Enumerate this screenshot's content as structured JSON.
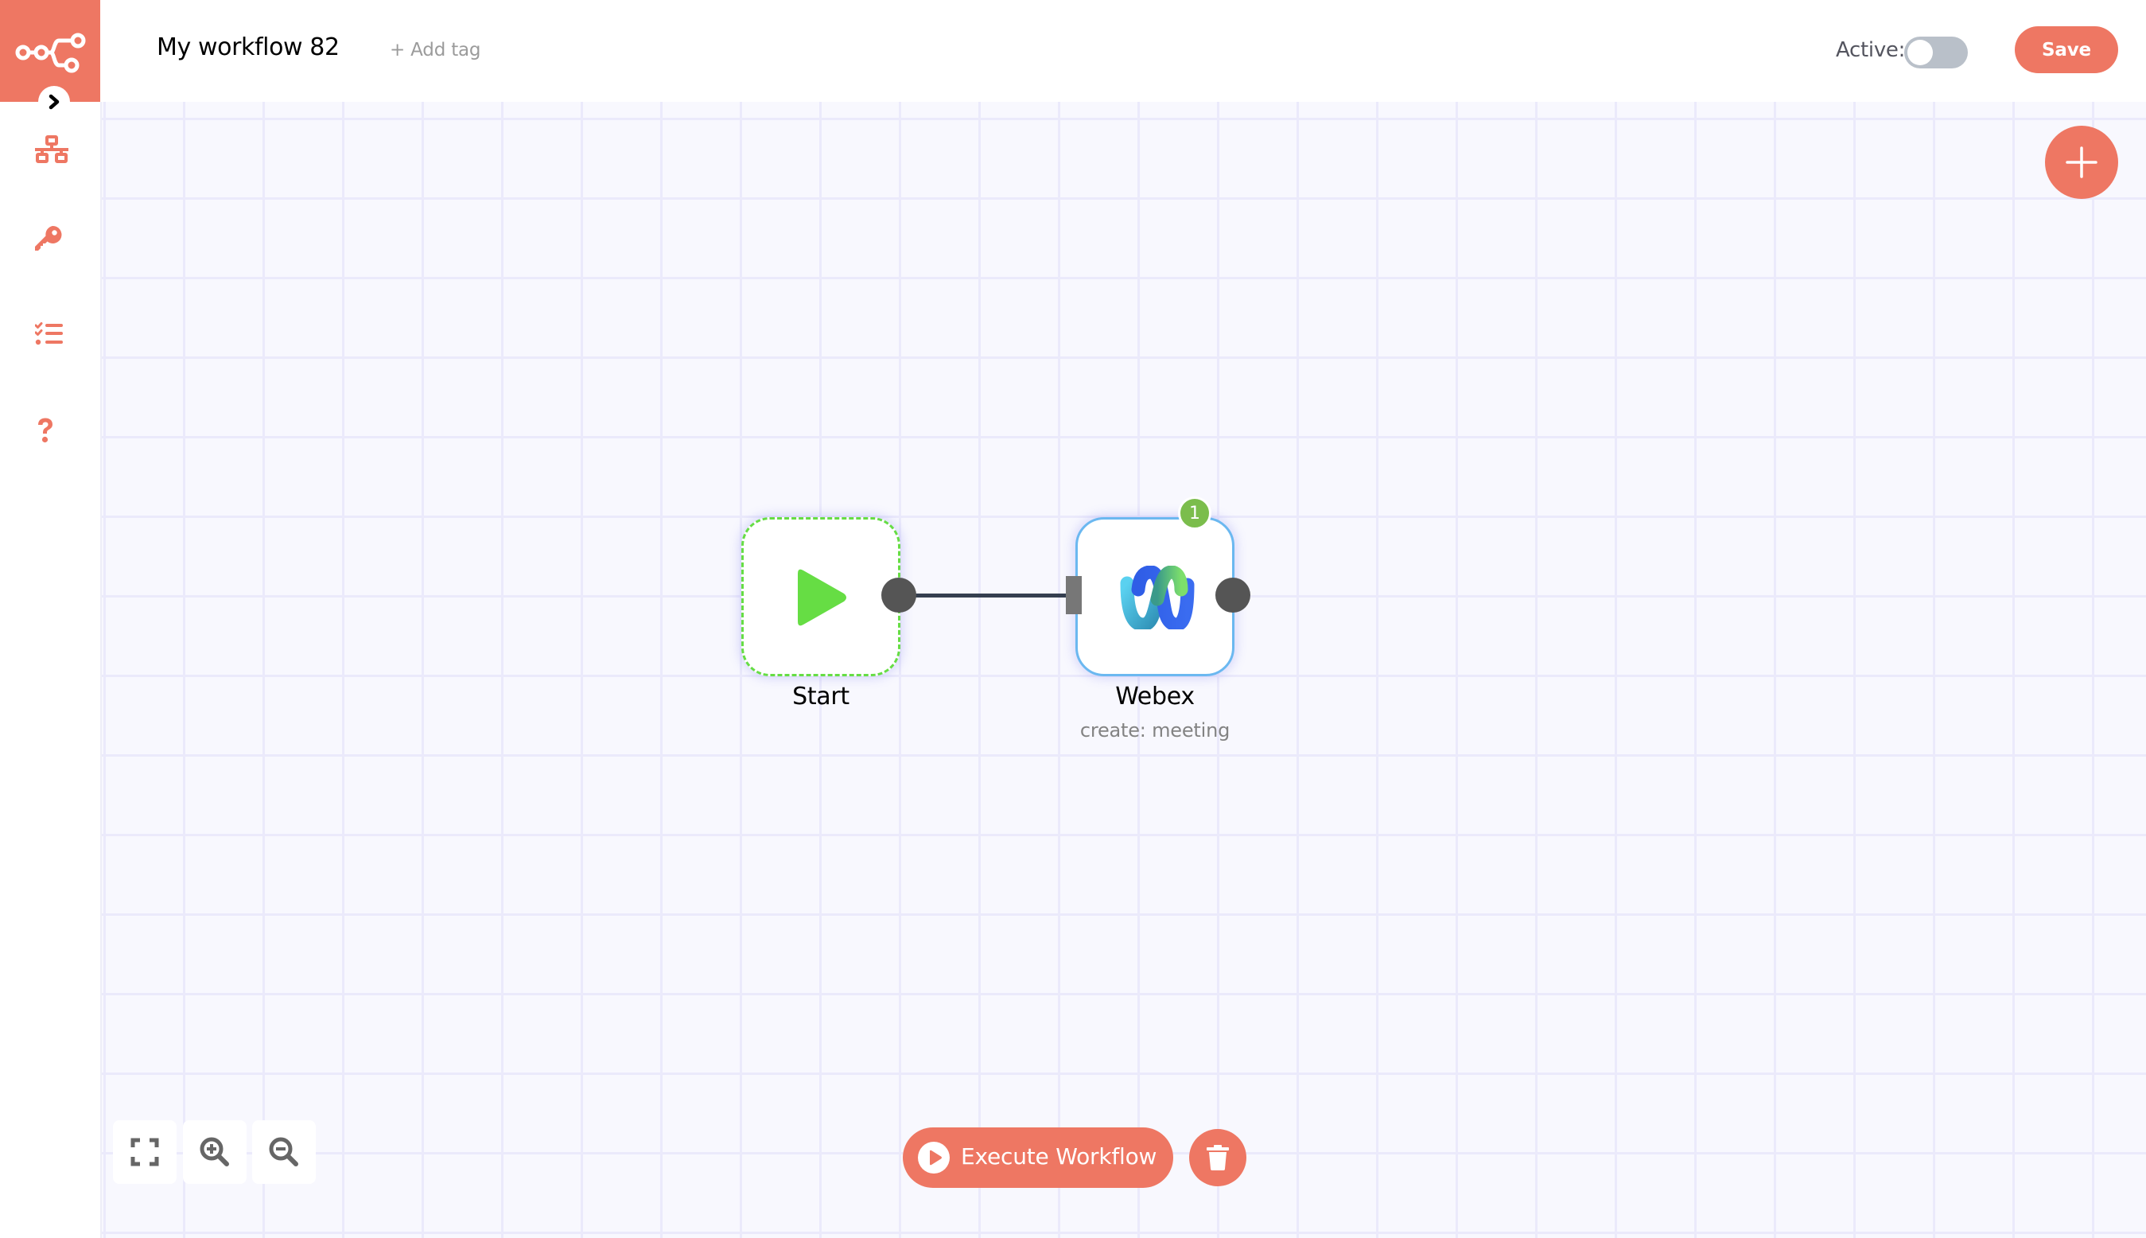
{
  "header": {
    "workflow_title": "My workflow 82",
    "add_tag_label": "+ Add tag",
    "active_label": "Active:",
    "active": false,
    "save_label": "Save"
  },
  "sidebar": {
    "logo_icon": "n8n-logo-icon",
    "expand_icon": "chevron-right-icon",
    "items": [
      {
        "name": "workflows",
        "icon": "network-icon"
      },
      {
        "name": "credentials",
        "icon": "key-icon"
      },
      {
        "name": "executions",
        "icon": "task-list-icon"
      },
      {
        "name": "help",
        "icon": "question-icon"
      }
    ]
  },
  "canvas": {
    "nodes": [
      {
        "id": "start",
        "label": "Start",
        "subtitle": "",
        "icon": "play-icon",
        "issues": 0
      },
      {
        "id": "webex",
        "label": "Webex",
        "subtitle": "create: meeting",
        "icon": "webex-logo-icon",
        "issues": 1
      }
    ],
    "connections": [
      {
        "from": "Start",
        "to": "Webex"
      }
    ],
    "badge_count": "1"
  },
  "controls": {
    "zoom_to_fit_icon": "fullscreen-icon",
    "zoom_in_icon": "zoom-in-icon",
    "zoom_out_icon": "zoom-out-icon",
    "add_node_icon": "plus-icon",
    "execute_label": "Execute Workflow",
    "delete_icon": "trash-icon"
  },
  "colors": {
    "brand": "#ee7763",
    "start_node_border": "#66dd44",
    "selected_node_border": "#6bb8f0",
    "issue_badge": "#7bbd4c",
    "canvas_bg": "#f8f8fe",
    "grid_line": "#ebeafb"
  }
}
